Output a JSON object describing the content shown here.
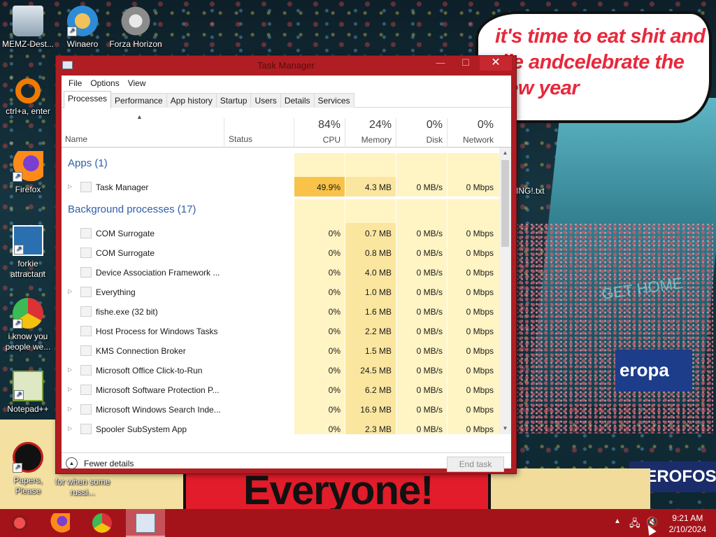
{
  "wallpaper": {
    "bubble_text": "it's time to eat shit and die andcelebrate the new year",
    "banner_text": "Everyone!",
    "sign1": "eropa",
    "sign2": "AEROFOS",
    "gethome": "GET HOME",
    "file_label": "ING!.txt"
  },
  "desktop": {
    "icons": [
      {
        "label": "MEMZ-Dest...",
        "icon": "recycle-bin-icon"
      },
      {
        "label": "Winaero",
        "icon": "winaero-icon"
      },
      {
        "label": "Forza Horizon",
        "icon": "forza-horizon-icon"
      },
      {
        "label": "ctrl+a, enter",
        "icon": "orange-ring-icon"
      },
      {
        "label": "Firefox",
        "icon": "firefox-icon"
      },
      {
        "label": "forkie attractant",
        "icon": "forkie-icon"
      },
      {
        "label": "i know you people we...",
        "icon": "chrome-icon"
      },
      {
        "label": "Notepad++",
        "icon": "notepadpp-icon"
      },
      {
        "label": "Papers, Please",
        "icon": "papers-please-icon"
      },
      {
        "label": "for when some russi...",
        "icon": "shortcut-icon"
      }
    ]
  },
  "task_manager": {
    "title": "Task Manager",
    "menu": [
      "File",
      "Options",
      "View"
    ],
    "tabs": [
      "Processes",
      "Performance",
      "App history",
      "Startup",
      "Users",
      "Details",
      "Services"
    ],
    "active_tab": "Processes",
    "columns": {
      "name": "Name",
      "status": "Status",
      "cpu": {
        "pct": "84%",
        "label": "CPU"
      },
      "memory": {
        "pct": "24%",
        "label": "Memory"
      },
      "disk": {
        "pct": "0%",
        "label": "Disk"
      },
      "network": {
        "pct": "0%",
        "label": "Network"
      }
    },
    "groups": {
      "apps": "Apps (1)",
      "background": "Background processes (17)"
    },
    "apps": [
      {
        "name": "Task Manager",
        "cpu": "49.9%",
        "mem": "4.3 MB",
        "disk": "0 MB/s",
        "net": "0 Mbps",
        "expandable": true
      }
    ],
    "background": [
      {
        "name": "COM Surrogate",
        "cpu": "0%",
        "mem": "0.7 MB",
        "disk": "0 MB/s",
        "net": "0 Mbps",
        "expandable": false
      },
      {
        "name": "COM Surrogate",
        "cpu": "0%",
        "mem": "0.8 MB",
        "disk": "0 MB/s",
        "net": "0 Mbps",
        "expandable": false
      },
      {
        "name": "Device Association Framework ...",
        "cpu": "0%",
        "mem": "4.0 MB",
        "disk": "0 MB/s",
        "net": "0 Mbps",
        "expandable": false
      },
      {
        "name": "Everything",
        "cpu": "0%",
        "mem": "1.0 MB",
        "disk": "0 MB/s",
        "net": "0 Mbps",
        "expandable": true
      },
      {
        "name": "fishe.exe (32 bit)",
        "cpu": "0%",
        "mem": "1.6 MB",
        "disk": "0 MB/s",
        "net": "0 Mbps",
        "expandable": false
      },
      {
        "name": "Host Process for Windows Tasks",
        "cpu": "0%",
        "mem": "2.2 MB",
        "disk": "0 MB/s",
        "net": "0 Mbps",
        "expandable": false
      },
      {
        "name": "KMS Connection Broker",
        "cpu": "0%",
        "mem": "1.5 MB",
        "disk": "0 MB/s",
        "net": "0 Mbps",
        "expandable": false
      },
      {
        "name": "Microsoft Office Click-to-Run",
        "cpu": "0%",
        "mem": "24.5 MB",
        "disk": "0 MB/s",
        "net": "0 Mbps",
        "expandable": true
      },
      {
        "name": "Microsoft Software Protection P...",
        "cpu": "0%",
        "mem": "6.2 MB",
        "disk": "0 MB/s",
        "net": "0 Mbps",
        "expandable": true
      },
      {
        "name": "Microsoft Windows Search Inde...",
        "cpu": "0%",
        "mem": "16.9 MB",
        "disk": "0 MB/s",
        "net": "0 Mbps",
        "expandable": true
      },
      {
        "name": "Spooler SubSystem App",
        "cpu": "0%",
        "mem": "2.3 MB",
        "disk": "0 MB/s",
        "net": "0 Mbps",
        "expandable": true
      }
    ],
    "footer": {
      "fewer_details": "Fewer details",
      "end_task": "End task"
    },
    "colors": {
      "cpu_hot": "#f8c348",
      "cpu_cool": "#fff4c4",
      "mem_warm": "#fbe6a0",
      "group_title": "#2d5fa8"
    }
  },
  "taskbar": {
    "items": [
      "start-orb-icon",
      "firefox-icon",
      "chrome-icon",
      "task-manager-icon"
    ],
    "active_item": "task-manager-icon",
    "time": "9:21 AM",
    "date": "2/10/2024"
  }
}
